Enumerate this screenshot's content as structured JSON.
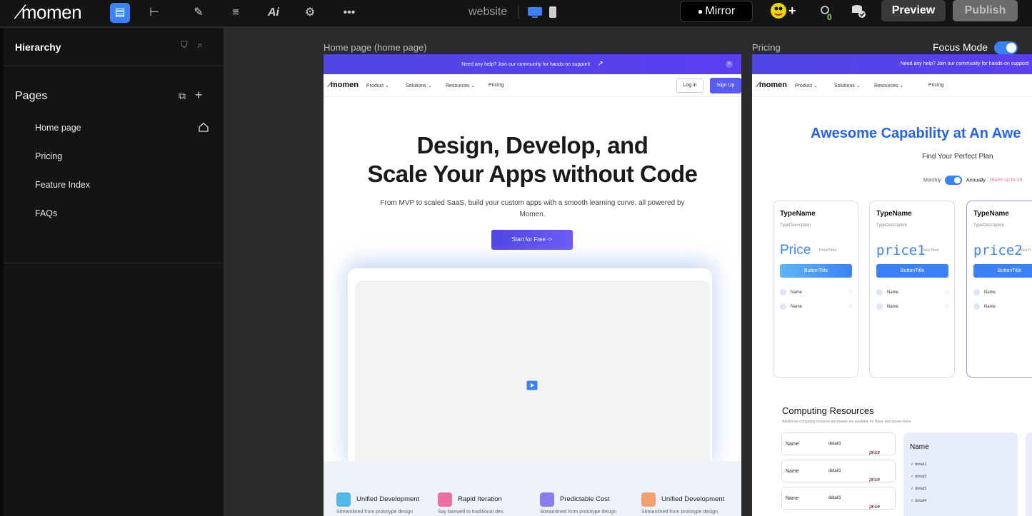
{
  "topbar": {
    "logo": "momen",
    "center_title": "website",
    "mirror_label": "Mirror",
    "preview_label": "Preview",
    "publish_label": "Publish",
    "badge_count": "0"
  },
  "sidebar": {
    "hierarchy_title": "Hierarchy",
    "pages_title": "Pages",
    "pages": [
      "Home page",
      "Pricing",
      "Feature Index",
      "FAQs"
    ]
  },
  "canvas": {
    "home_label": "Home page (home page)",
    "pricing_label": "Pricing",
    "focus_mode_label": "Focus Mode",
    "focus_mode_on": true
  },
  "home": {
    "banner": "Need any help? Join our community for hands-on support!",
    "brand": "momen",
    "nav": [
      "Product",
      "Solutions",
      "Resources",
      "Pricing"
    ],
    "login": "Log in",
    "signup": "Sign Up",
    "hero_line1": "Design, Develop, and",
    "hero_line2": "Scale Your Apps without Code",
    "hero_sub": "From MVP to scaled SaaS, build your custom apps with a smooth learning curve, all powered by Momen.",
    "cta": "Start for Free ->",
    "features": [
      {
        "title": "Unified Development",
        "sub": "Streamlined from prototype design",
        "color": "#4fb9e8"
      },
      {
        "title": "Rapid Iteration",
        "sub": "Say farewell to traditional dev.",
        "color": "#f06fa3"
      },
      {
        "title": "Predictable Cost",
        "sub": "Streamlined from prototype design",
        "color": "#8b7cf0"
      },
      {
        "title": "Unified Development",
        "sub": "Streamlined from prototype design",
        "color": "#f2a06f"
      }
    ]
  },
  "pricing": {
    "banner": "Need any help? Join our community for hands-on support!",
    "brand": "momen",
    "nav": [
      "Product",
      "Solutions",
      "Resources",
      "Pricing"
    ],
    "title": "Awesome Capability at An Awe",
    "subtitle": "Find Your Perfect Plan",
    "monthly": "Monthly",
    "annually": "Annually",
    "save_note": "(Save up to 15",
    "cards": [
      {
        "name": "TypeName",
        "desc": "TypeDescription",
        "price": "Price",
        "price_time": "PriceTime",
        "button": "ButtonTitle",
        "rows": [
          "Name",
          "Name"
        ]
      },
      {
        "name": "TypeName",
        "desc": "TypeDescription",
        "price": "price1",
        "price_time": "PriceTime",
        "button": "ButtonTitle",
        "rows": [
          "Name",
          "Name"
        ]
      },
      {
        "name": "TypeName",
        "desc": "TypeDescription",
        "price": "price2",
        "price_time": "PriceTi",
        "button": "ButtonTitle",
        "rows": [
          "Name",
          "Name"
        ]
      }
    ],
    "computing_title": "Computing Resources",
    "computing_sub": "Additional computing resource purchases are available for Basic and above plans.",
    "computing_rows": [
      {
        "name": "Name",
        "detail": "detail1",
        "price": "price",
        "time": "time"
      },
      {
        "name": "Name",
        "detail": "detail1",
        "price": "price",
        "time": "time"
      },
      {
        "name": "Name",
        "detail": "detail1",
        "price": "price",
        "time": "time"
      }
    ],
    "panel_name": "Name",
    "panel_details": [
      "detail1",
      "detail2",
      "detail3",
      "detail4"
    ]
  }
}
